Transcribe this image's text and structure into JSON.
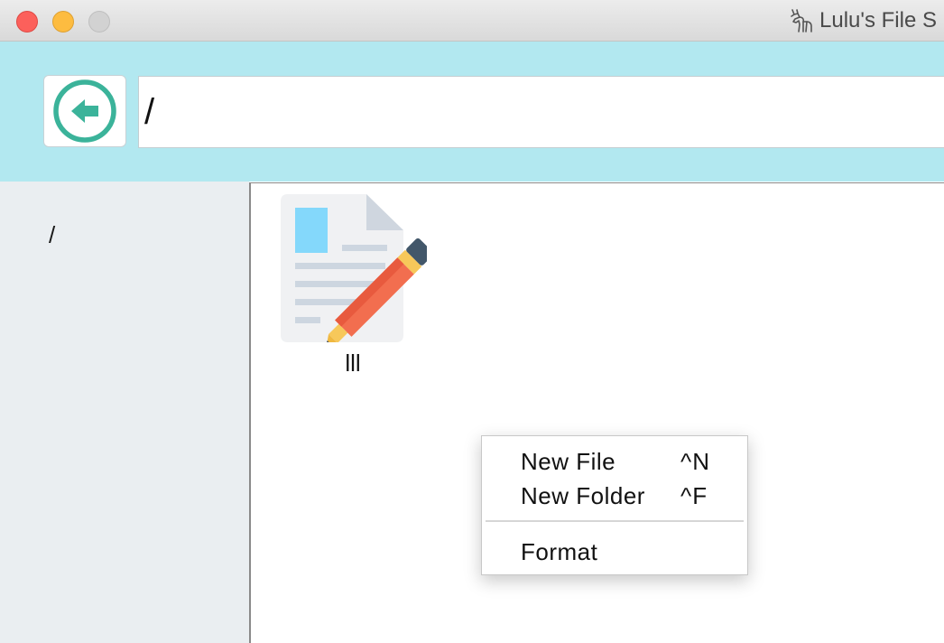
{
  "window": {
    "title": "Lulu's File S",
    "app_icon": "deer-icon",
    "controls": [
      "close",
      "minimize",
      "zoom"
    ],
    "colors": {
      "close": "#fc605b",
      "minimize": "#fdbc40",
      "zoom": "#d2d2d2"
    }
  },
  "toolbar": {
    "back_icon": "arrow-left-circle-icon",
    "path_value": "/",
    "background": "#b2e8f0",
    "accent": "#3bb39a"
  },
  "sidebar": {
    "items": [
      {
        "label": "/"
      }
    ]
  },
  "content": {
    "files": [
      {
        "name": "lll",
        "icon": "document-edit-icon"
      }
    ]
  },
  "context_menu": {
    "items": [
      {
        "label": "New File",
        "shortcut": "^N"
      },
      {
        "label": "New Folder",
        "shortcut": "^F"
      },
      {
        "label": "Format",
        "shortcut": ""
      }
    ]
  }
}
